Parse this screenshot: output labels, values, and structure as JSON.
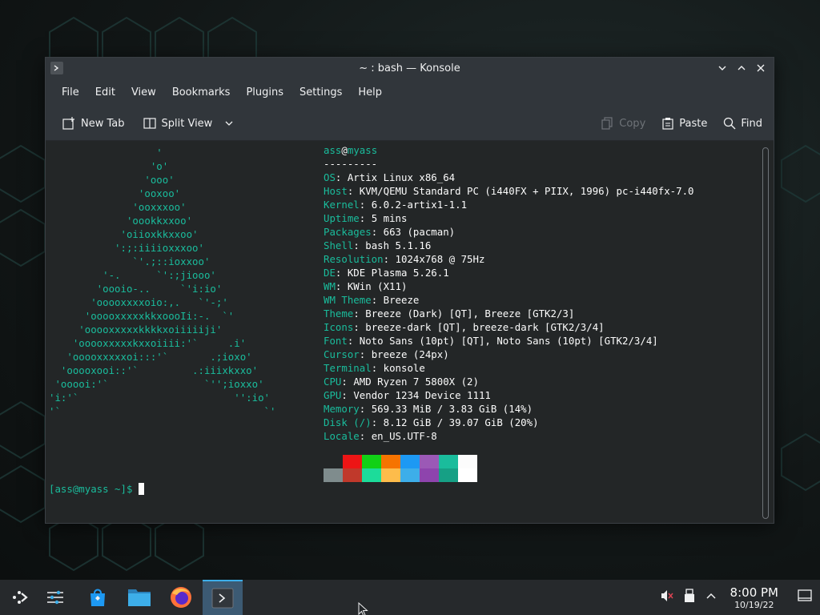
{
  "window": {
    "title": "~ : bash — Konsole",
    "menu": [
      "File",
      "Edit",
      "View",
      "Bookmarks",
      "Plugins",
      "Settings",
      "Help"
    ],
    "toolbar": {
      "new_tab": "New Tab",
      "split_view": "Split View",
      "copy": "Copy",
      "paste": "Paste",
      "find": "Find"
    }
  },
  "terminal": {
    "ascii_art": "                  '\n                 'o'\n                'ooo'\n               'ooxoo'\n              'ooxxxoo'\n             'oookkxxoo'\n            'oiioxkkxxoo'\n           ':;:iiiioxxxoo'\n              `'.;::ioxxoo'\n         '-.      `':;jiooo'\n        'oooio-..     `'i:io'\n       'ooooxxxxoio:,.   `'-;'\n      'ooooxxxxxkkxoooIi:-.  `'\n     'ooooxxxxxkkkkxoiiiiiji'\n    'ooooxxxxxkxxoiiii:'`     .i'\n   'ooooxxxxxoi:::'`       .;ioxo'\n  'ooooxooi::'`         .:iiixkxxo'\n 'ooooi:'`                `'';ioxxo'\n'i:'`                          '':io'\n'`                                  `'",
    "user": "ass",
    "host": "myass",
    "separator": "---------",
    "info": [
      {
        "key": "OS",
        "value": "Artix Linux x86_64"
      },
      {
        "key": "Host",
        "value": "KVM/QEMU Standard PC (i440FX + PIIX, 1996) pc-i440fx-7.0"
      },
      {
        "key": "Kernel",
        "value": "6.0.2-artix1-1.1"
      },
      {
        "key": "Uptime",
        "value": "5 mins"
      },
      {
        "key": "Packages",
        "value": "663 (pacman)"
      },
      {
        "key": "Shell",
        "value": "bash 5.1.16"
      },
      {
        "key": "Resolution",
        "value": "1024x768 @ 75Hz"
      },
      {
        "key": "DE",
        "value": "KDE Plasma 5.26.1"
      },
      {
        "key": "WM",
        "value": "KWin (X11)"
      },
      {
        "key": "WM Theme",
        "value": "Breeze"
      },
      {
        "key": "Theme",
        "value": "Breeze (Dark) [QT], Breeze [GTK2/3]"
      },
      {
        "key": "Icons",
        "value": "breeze-dark [QT], breeze-dark [GTK2/3/4]"
      },
      {
        "key": "Font",
        "value": "Noto Sans (10pt) [QT], Noto Sans (10pt) [GTK2/3/4]"
      },
      {
        "key": "Cursor",
        "value": "breeze (24px)"
      },
      {
        "key": "Terminal",
        "value": "konsole"
      },
      {
        "key": "CPU",
        "value": "AMD Ryzen 7 5800X (2)"
      },
      {
        "key": "GPU",
        "value": "Vendor 1234 Device 1111"
      },
      {
        "key": "Memory",
        "value": "569.33 MiB / 3.83 GiB (14%)"
      },
      {
        "key": "Disk (/)",
        "value": "8.12 GiB / 39.07 GiB (20%)"
      },
      {
        "key": "Locale",
        "value": "en_US.UTF-8"
      }
    ],
    "palette_top": [
      "#232627",
      "#ed1515",
      "#11d116",
      "#f67400",
      "#1d99f3",
      "#9b59b6",
      "#1abc9c",
      "#fcfcfc"
    ],
    "palette_bottom": [
      "#7f8c8d",
      "#c0392b",
      "#1cdc9a",
      "#fdbc4b",
      "#3daee9",
      "#8e44ad",
      "#16a085",
      "#ffffff"
    ],
    "prompt": "[ass@myass ~]$ "
  },
  "taskbar": {
    "time": "8:00 PM",
    "date": "10/19/22",
    "apps": [
      "application-launcher-icon",
      "system-settings-icon",
      "discover-icon",
      "dolphin-icon",
      "firefox-icon",
      "konsole-icon"
    ]
  },
  "colors": {
    "accent": "#3daee9",
    "teal": "#1abc9c",
    "panel": "#31363b",
    "terminal_bg": "#232627"
  }
}
